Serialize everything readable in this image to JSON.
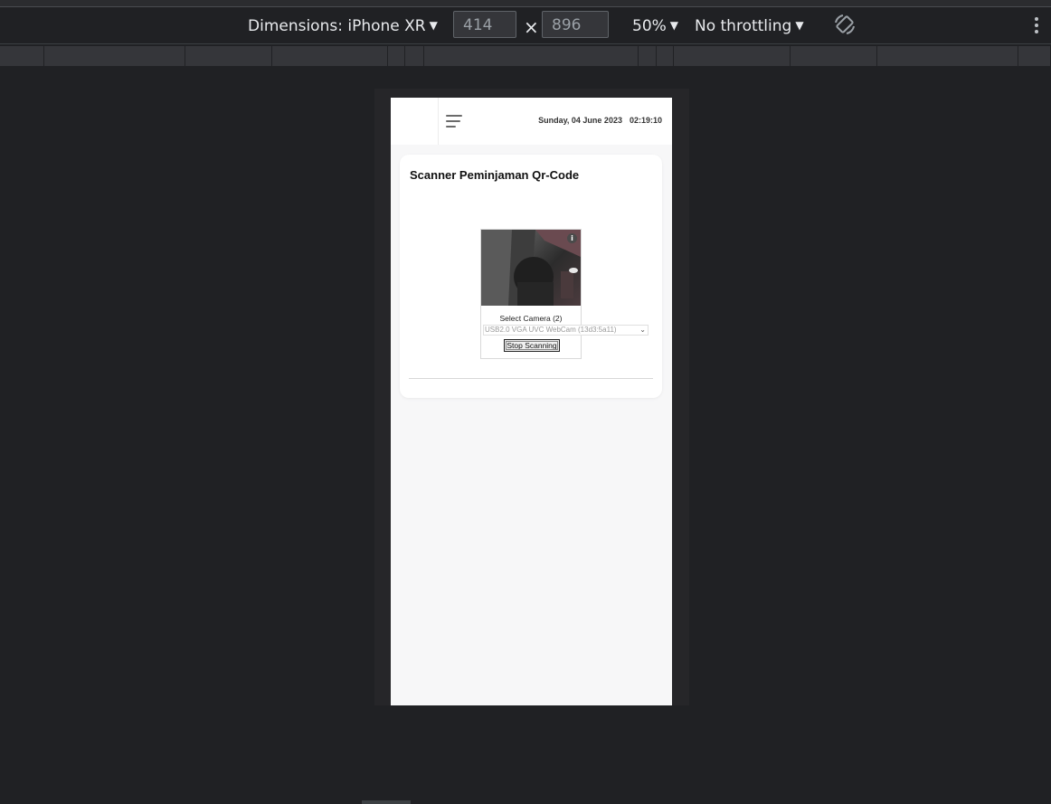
{
  "toolbar": {
    "dimensions_label": "Dimensions: iPhone XR",
    "width_value": "414",
    "height_value": "896",
    "times": "×",
    "zoom": "50%",
    "throttling": "No throttling",
    "caret": "▼"
  },
  "icons": {
    "rotate": "rotate-icon",
    "more": "kebab-menu-icon",
    "menu": "hamburger-menu-icon",
    "info": "info-icon",
    "torch": "torch-icon"
  },
  "app": {
    "date": "Sunday, 04 June 2023",
    "time": "02:19:10",
    "card_title": "Scanner Peminjaman Qr-Code",
    "scanner": {
      "info_glyph": "i",
      "select_label": "Select Camera (2)",
      "camera_option": "USB2.0 VGA UVC WebCam (13d3:5a11)",
      "chevron": "⌄",
      "stop_button": "Stop Scanning"
    }
  },
  "colors": {
    "devtools_bg": "#202124",
    "device_bg": "#f7f7f8",
    "card_bg": "#ffffff"
  }
}
